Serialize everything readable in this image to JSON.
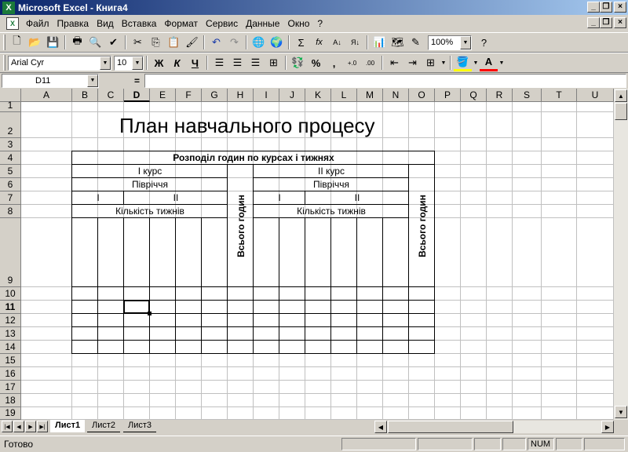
{
  "window": {
    "title": "Microsoft Excel - Книга4",
    "min": "_",
    "restore": "❐",
    "close": "×"
  },
  "menu": [
    "Файл",
    "Правка",
    "Вид",
    "Вставка",
    "Формат",
    "Сервис",
    "Данные",
    "Окно",
    "?"
  ],
  "toolbar": {
    "zoom": "100%",
    "font": "Arial Cyr",
    "size": "10",
    "bold": "Ж",
    "italic": "К",
    "underline": "Ч",
    "percent": "%",
    "comma": ",",
    "sigma": "Σ",
    "fx": "fx"
  },
  "formula": {
    "name_box": "D11",
    "equals": "=",
    "value": ""
  },
  "columns": [
    "A",
    "B",
    "C",
    "D",
    "E",
    "F",
    "G",
    "H",
    "I",
    "J",
    "K",
    "L",
    "M",
    "N",
    "O",
    "P",
    "Q",
    "R",
    "S",
    "T",
    "U"
  ],
  "rows": [
    "1",
    "2",
    "3",
    "4",
    "5",
    "6",
    "7",
    "8",
    "9",
    "10",
    "11",
    "12",
    "13",
    "14",
    "15",
    "16",
    "17",
    "18",
    "19"
  ],
  "selected": {
    "column": "D",
    "row": "11"
  },
  "cells": {
    "title": "План навчального процесу",
    "header": "Розподіл годин по курсах і тижнях",
    "course1": "I курс",
    "course2": "II курс",
    "semester1": "Півріччя",
    "semester2": "Півріччя",
    "c1_half1": "I",
    "c1_half2": "II",
    "c2_half1": "I",
    "c2_half2": "II",
    "weeks1": "Кількість тижнів",
    "weeks2": "Кількість тижнів",
    "total1": "Всього годин",
    "total2": "Всього годин"
  },
  "sheets": [
    "Лист1",
    "Лист2",
    "Лист3"
  ],
  "status": {
    "ready": "Готово",
    "num": "NUM"
  }
}
